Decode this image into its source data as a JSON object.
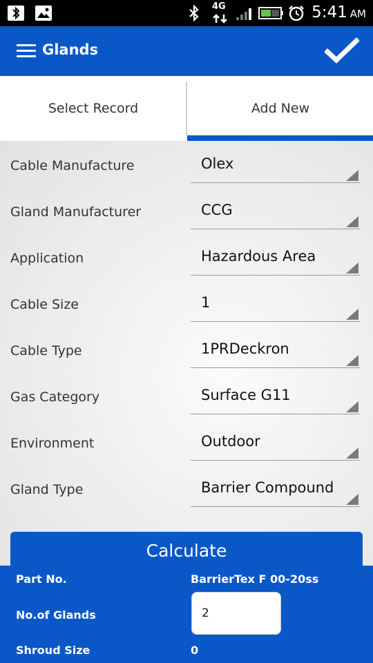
{
  "status_bar": {
    "time": "5:41",
    "ampm": "AM",
    "network": "4G",
    "icons": [
      "bluetooth-icon",
      "image-icon",
      "bluetooth-icon",
      "network-4g-icon",
      "signal-icon",
      "battery-icon",
      "alarm-icon"
    ]
  },
  "app_bar": {
    "title": "Glands",
    "menu_icon": "hamburger-menu-icon",
    "confirm_icon": "checkmark-icon"
  },
  "tabs": [
    {
      "label": "Select Record",
      "selected": false
    },
    {
      "label": "Add New",
      "selected": true
    }
  ],
  "form": {
    "fields": [
      {
        "label": "Cable Manufacture",
        "value": "Olex"
      },
      {
        "label": "Gland Manufacturer",
        "value": "CCG"
      },
      {
        "label": "Application",
        "value": "Hazardous Area"
      },
      {
        "label": "Cable Size",
        "value": "1"
      },
      {
        "label": "Cable Type",
        "value": "1PRDeckron"
      },
      {
        "label": "Gas Category",
        "value": "Surface G11"
      },
      {
        "label": "Environment",
        "value": "Outdoor"
      },
      {
        "label": "Gland Type",
        "value": "Barrier Compound"
      }
    ],
    "calculate_label": "Calculate"
  },
  "results": {
    "part_no_label": "Part No.",
    "part_no_value": "BarrierTex F 00-20ss",
    "glands_label": "No.of Glands",
    "glands_value": "2",
    "shroud_label": "Shroud Size",
    "shroud_value": "0"
  },
  "colors": {
    "primary": "#0a58c8",
    "status_bar": "#000000"
  }
}
